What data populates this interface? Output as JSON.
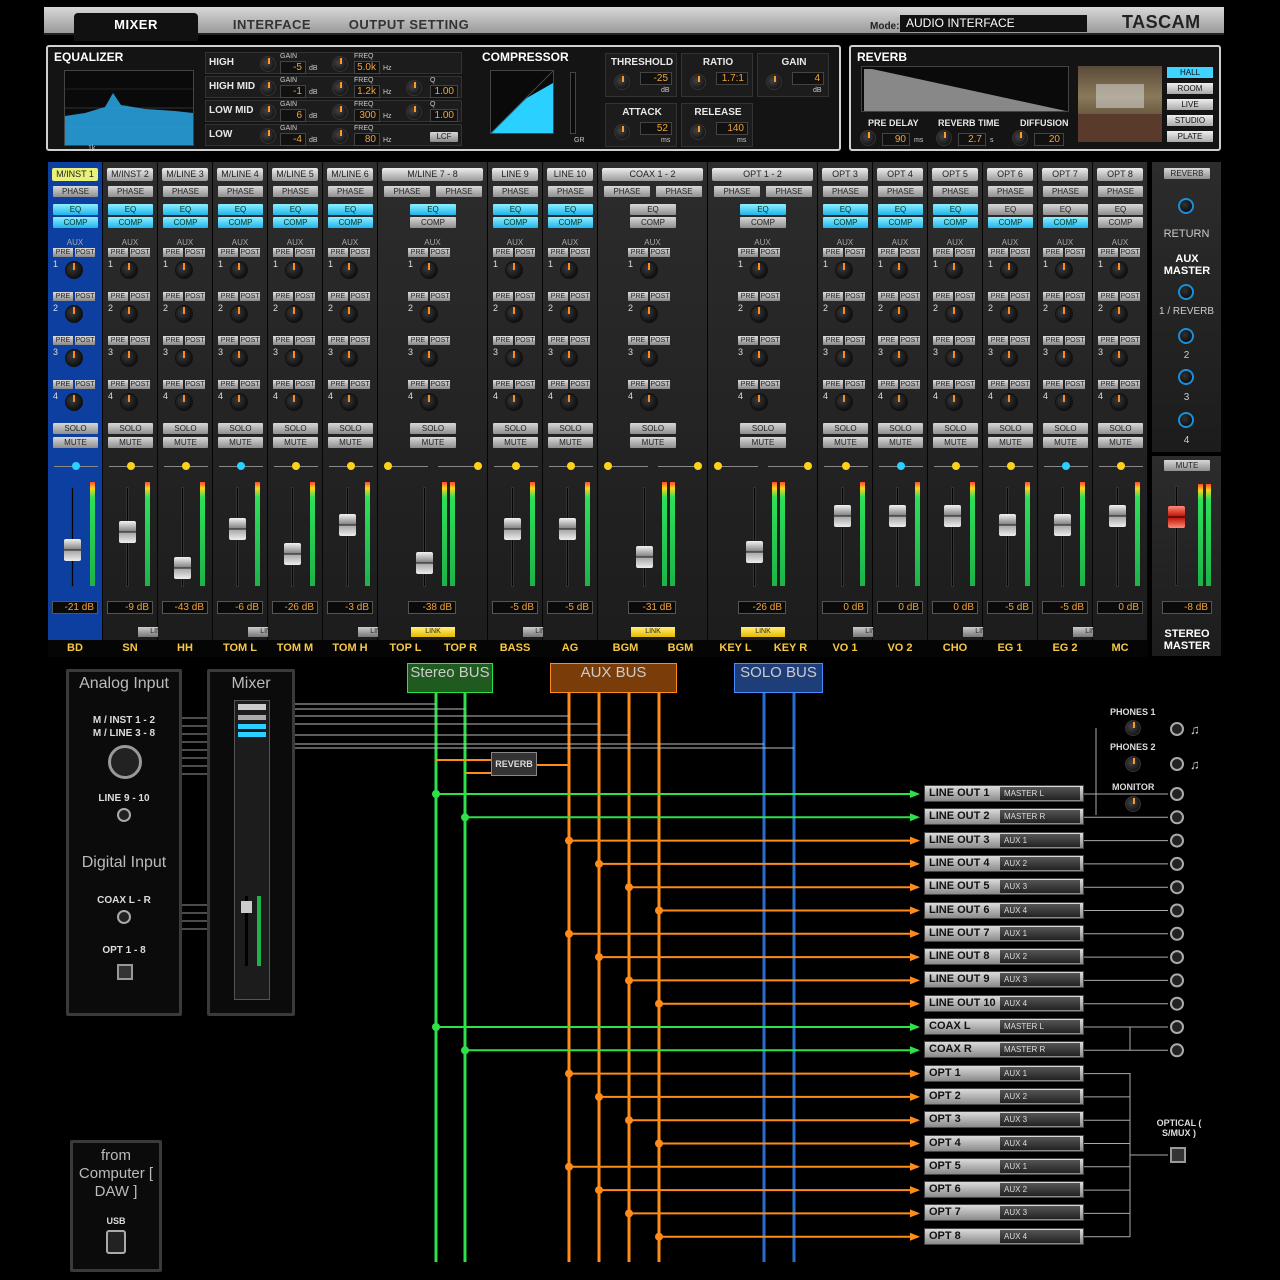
{
  "tabs": {
    "mixer": "MIXER",
    "interface": "INTERFACE",
    "output": "OUTPUT SETTING"
  },
  "mode": {
    "label": "Mode:",
    "value": "AUDIO INTERFACE"
  },
  "brand": "TASCAM",
  "eq": {
    "title": "EQUALIZER",
    "yticks": [
      "15.0",
      "10",
      "5",
      "0",
      "-5",
      "-10",
      "-15"
    ],
    "xticks": [
      "20",
      "100",
      "1k",
      "10k",
      "20k Hz"
    ],
    "bands": [
      {
        "name": "HIGH",
        "gain": "-5",
        "freq": "5.0k",
        "q": ""
      },
      {
        "name": "HIGH MID",
        "gain": "-1",
        "freq": "1.2k",
        "q": "1.00"
      },
      {
        "name": "LOW MID",
        "gain": "6",
        "freq": "300",
        "q": "1.00"
      },
      {
        "name": "LOW",
        "gain": "-4",
        "freq": "80",
        "q": "LCF"
      }
    ],
    "gain_lbl": "GAIN",
    "freq_lbl": "FREQ",
    "q_lbl": "Q",
    "db": "dB",
    "hz": "Hz"
  },
  "comp": {
    "title": "COMPRESSOR",
    "yticks": [
      "0",
      "-12",
      "-24",
      "-36",
      "-48"
    ],
    "xticks": [
      "-48",
      "-36",
      "-24",
      "-12",
      "0"
    ],
    "gr": "GR",
    "threshold": {
      "label": "THRESHOLD",
      "value": "-25",
      "unit": "dB"
    },
    "ratio": {
      "label": "RATIO",
      "value": "1.7:1"
    },
    "gain": {
      "label": "GAIN",
      "value": "4",
      "unit": "dB"
    },
    "attack": {
      "label": "ATTACK",
      "value": "52",
      "unit": "ms"
    },
    "release": {
      "label": "RELEASE",
      "value": "140",
      "unit": "ms"
    }
  },
  "reverb": {
    "title": "REVERB",
    "predelay": {
      "label": "PRE DELAY",
      "value": "90",
      "unit": "ms"
    },
    "time": {
      "label": "REVERB TIME",
      "value": "2.7",
      "unit": "s"
    },
    "diffusion": {
      "label": "DIFFUSION",
      "value": "20"
    },
    "types": [
      "HALL",
      "ROOM",
      "LIVE",
      "STUDIO",
      "PLATE"
    ],
    "selected": "HALL"
  },
  "channels": [
    {
      "name": "M/INST 1",
      "bottom": "BD",
      "db": "-21 dB",
      "eq": true,
      "comp": true,
      "phase": "PHASE",
      "fader": 0.42,
      "link": false
    },
    {
      "name": "M/INST 2",
      "bottom": "SN",
      "db": "-9 dB",
      "eq": true,
      "comp": true,
      "fader": 0.62,
      "link": false
    },
    {
      "name": "M/LINE 3",
      "bottom": "HH",
      "db": "-43 dB",
      "eq": true,
      "comp": true,
      "fader": 0.22,
      "link": false
    },
    {
      "name": "M/LINE 4",
      "bottom": "TOM L",
      "db": "-6 dB",
      "eq": true,
      "comp": true,
      "fader": 0.66,
      "link": true
    },
    {
      "name": "M/LINE 5",
      "bottom": "TOM M",
      "db": "-26 dB",
      "eq": true,
      "comp": true,
      "fader": 0.38,
      "link": false
    },
    {
      "name": "M/LINE 6",
      "bottom": "TOM H",
      "db": "-3 dB",
      "eq": true,
      "comp": true,
      "fader": 0.7,
      "link": true
    },
    {
      "name": "M/LINE 7 - 8",
      "bottom": "TOP L",
      "bottom2": "TOP R",
      "db": "-38 dB",
      "eq": true,
      "comp": false,
      "fader": 0.28,
      "link": true,
      "wide": true
    },
    {
      "name": "LINE 9",
      "bottom": "BASS",
      "db": "-5 dB",
      "eq": true,
      "comp": true,
      "fader": 0.66,
      "link": false
    },
    {
      "name": "LINE 10",
      "bottom": "AG",
      "db": "-5 dB",
      "eq": true,
      "comp": true,
      "fader": 0.66,
      "link": true
    },
    {
      "name": "COAX 1 - 2",
      "bottom": "BGM",
      "bottom2": "BGM",
      "db": "-31 dB",
      "eq": false,
      "comp": false,
      "fader": 0.34,
      "link": true,
      "wide": true
    },
    {
      "name": "OPT 1 - 2",
      "bottom": "KEY L",
      "bottom2": "KEY R",
      "db": "-26 dB",
      "eq": true,
      "comp": false,
      "fader": 0.4,
      "link": true,
      "wide": true
    },
    {
      "name": "OPT 3",
      "bottom": "VO 1",
      "db": "0 dB",
      "eq": true,
      "comp": true,
      "fader": 0.8,
      "link": false
    },
    {
      "name": "OPT 4",
      "bottom": "VO 2",
      "db": "0 dB",
      "eq": true,
      "comp": true,
      "fader": 0.8,
      "link": true
    },
    {
      "name": "OPT 5",
      "bottom": "CHO",
      "db": "0 dB",
      "eq": true,
      "comp": true,
      "fader": 0.8,
      "link": false
    },
    {
      "name": "OPT 6",
      "bottom": "EG 1",
      "db": "-5 dB",
      "eq": false,
      "comp": true,
      "fader": 0.7,
      "link": true
    },
    {
      "name": "OPT 7",
      "bottom": "EG 2",
      "db": "-5 dB",
      "eq": false,
      "comp": true,
      "fader": 0.7,
      "link": false
    },
    {
      "name": "OPT 8",
      "bottom": "MC",
      "db": "0 dB",
      "eq": false,
      "comp": false,
      "fader": 0.8,
      "link": true
    }
  ],
  "labels": {
    "phase": "PHASE",
    "eq": "EQ",
    "comp": "COMP",
    "aux": "AUX",
    "pre": "PRE",
    "post": "POST",
    "solo": "SOLO",
    "mute": "MUTE",
    "link": "LINK",
    "lcr": "L C R"
  },
  "return": {
    "btn": "REVERB",
    "label": "RETURN",
    "auxmaster": "AUX MASTER",
    "aux1": "1 / REVERB",
    "aux2": "2",
    "aux3": "3",
    "aux4": "4",
    "mute": "MUTE",
    "db": "-8 dB",
    "master": "STEREO MASTER"
  },
  "routing": {
    "analog": "Analog Input",
    "mixer": "Mixer",
    "minst": "M / INST 1 - 2",
    "mline": "M / LINE 3 - 8",
    "line910": "LINE 9 - 10",
    "digital": "Digital Input",
    "coax": "COAX L - R",
    "opt": "OPT 1 - 8",
    "fromcomp": "from Computer [ DAW ]",
    "usb": "USB",
    "stereobus": "Stereo BUS",
    "auxbus": "AUX BUS",
    "solobus": "SOLO BUS",
    "reverb": "REVERB",
    "phones1": "PHONES 1",
    "phones2": "PHONES 2",
    "monitor": "MONITOR",
    "optical": "OPTICAL ( S/MUX )",
    "outputs": [
      {
        "n": "LINE OUT 1",
        "s": "MASTER L",
        "c": "g"
      },
      {
        "n": "LINE OUT 2",
        "s": "MASTER R",
        "c": "g"
      },
      {
        "n": "LINE OUT 3",
        "s": "AUX 1",
        "c": "o"
      },
      {
        "n": "LINE OUT 4",
        "s": "AUX 2",
        "c": "o"
      },
      {
        "n": "LINE OUT 5",
        "s": "AUX 3",
        "c": "o"
      },
      {
        "n": "LINE OUT 6",
        "s": "AUX 4",
        "c": "o"
      },
      {
        "n": "LINE OUT 7",
        "s": "AUX 1",
        "c": "o"
      },
      {
        "n": "LINE OUT 8",
        "s": "AUX 2",
        "c": "o"
      },
      {
        "n": "LINE OUT 9",
        "s": "AUX 3",
        "c": "o"
      },
      {
        "n": "LINE OUT 10",
        "s": "AUX 4",
        "c": "o"
      },
      {
        "n": "COAX L",
        "s": "MASTER L",
        "c": "g"
      },
      {
        "n": "COAX R",
        "s": "MASTER R",
        "c": "g"
      },
      {
        "n": "OPT 1",
        "s": "AUX 1",
        "c": "o"
      },
      {
        "n": "OPT 2",
        "s": "AUX 2",
        "c": "o"
      },
      {
        "n": "OPT 3",
        "s": "AUX 3",
        "c": "o"
      },
      {
        "n": "OPT 4",
        "s": "AUX 4",
        "c": "o"
      },
      {
        "n": "OPT 5",
        "s": "AUX 1",
        "c": "o"
      },
      {
        "n": "OPT 6",
        "s": "AUX 2",
        "c": "o"
      },
      {
        "n": "OPT 7",
        "s": "AUX 3",
        "c": "o"
      },
      {
        "n": "OPT 8",
        "s": "AUX 4",
        "c": "o"
      }
    ]
  },
  "colors": {
    "green": "#2ee04a",
    "orange": "#ff8c1a",
    "blue": "#2a6ccf",
    "cyan": "#2ad0ff"
  }
}
